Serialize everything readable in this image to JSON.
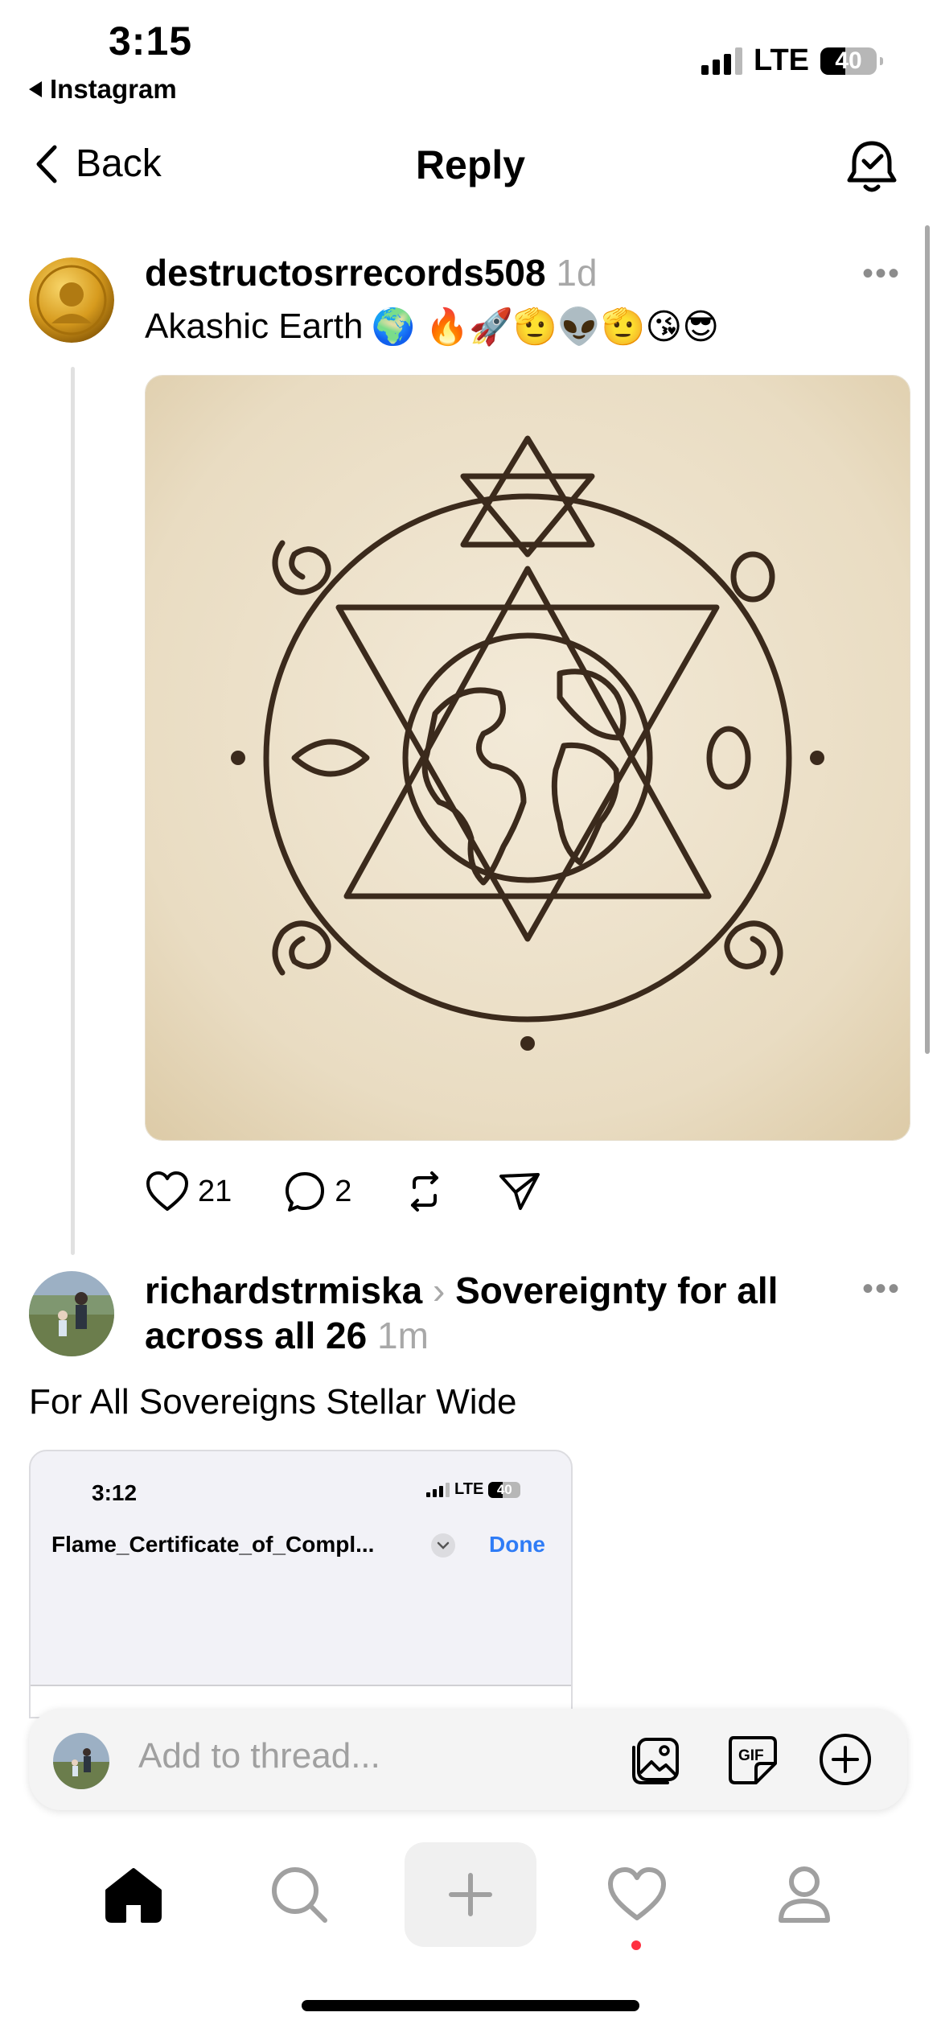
{
  "status_bar": {
    "time": "3:15",
    "back_app": "Instagram",
    "network": "LTE",
    "battery": "40"
  },
  "nav": {
    "back_label": "Back",
    "title": "Reply",
    "bell_icon": "bell-check-icon"
  },
  "post1": {
    "username": "destructosrrecords508",
    "time": "1d",
    "text": "Akashic Earth",
    "emojis": "🌍 🔥🚀🫡👽🫡😘😎",
    "more": "•••",
    "likes": "21",
    "replies": "2",
    "image_desc": "sacred geometry earth"
  },
  "post2": {
    "username": "richardstrmiska",
    "separator": "›",
    "topic": "Sovereignty for all across all 26",
    "time": "1m",
    "more": "•••",
    "body": "For All Sovereigns Stellar Wide",
    "embed": {
      "time": "3:12",
      "network": "LTE",
      "battery": "40",
      "file_title": "Flame_Certificate_of_Compl...",
      "done_label": "Done"
    }
  },
  "composer": {
    "placeholder": "Add to thread...",
    "gif_label": "GIF"
  },
  "tabbar": {
    "items": [
      "home",
      "search",
      "create",
      "activity",
      "profile"
    ]
  },
  "colors": {
    "accent_blue": "#2f7cf6",
    "muted": "#a8a8a8",
    "notification": "#ff3040",
    "parchment": "#e9dcc2",
    "ink": "#3b2a1c"
  }
}
